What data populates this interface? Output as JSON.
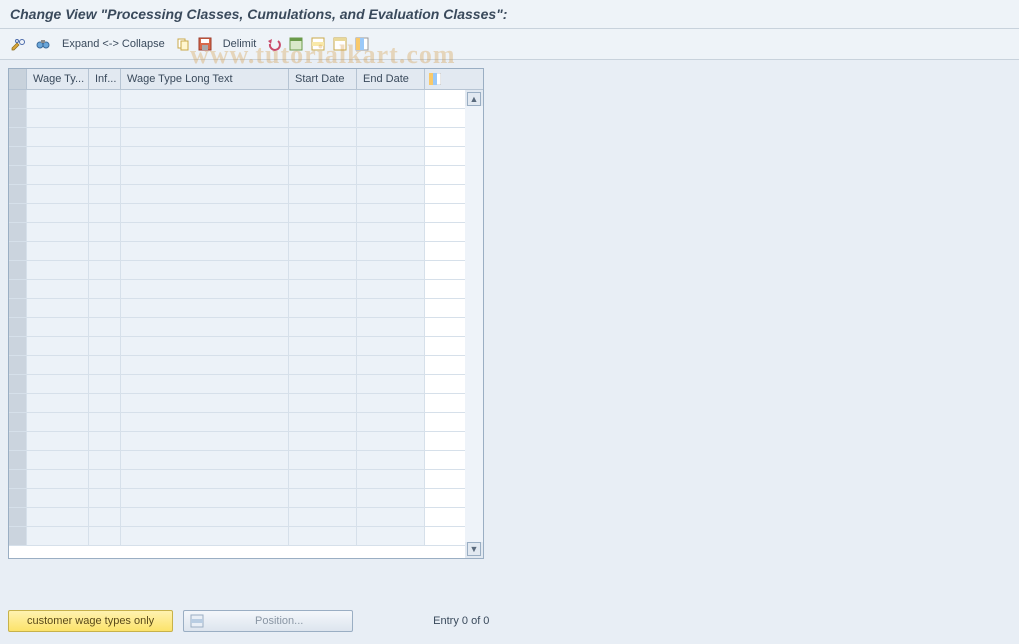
{
  "title": "Change View \"Processing Classes, Cumulations, and Evaluation Classes\":",
  "toolbar": {
    "expand_collapse_label": "Expand <-> Collapse",
    "delimit_label": "Delimit"
  },
  "columns": {
    "wage_type": "Wage Ty...",
    "inf": "Inf...",
    "long_text": "Wage Type Long Text",
    "start_date": "Start Date",
    "end_date": "End Date"
  },
  "rows": [
    {},
    {},
    {},
    {},
    {},
    {},
    {},
    {},
    {},
    {},
    {},
    {},
    {},
    {},
    {},
    {},
    {},
    {},
    {},
    {},
    {},
    {},
    {},
    {}
  ],
  "footer": {
    "customer_wage_types_label": "customer wage types only",
    "position_label": "Position...",
    "entry_text": "Entry 0 of 0"
  },
  "watermark": "www.tutorialkart.com"
}
